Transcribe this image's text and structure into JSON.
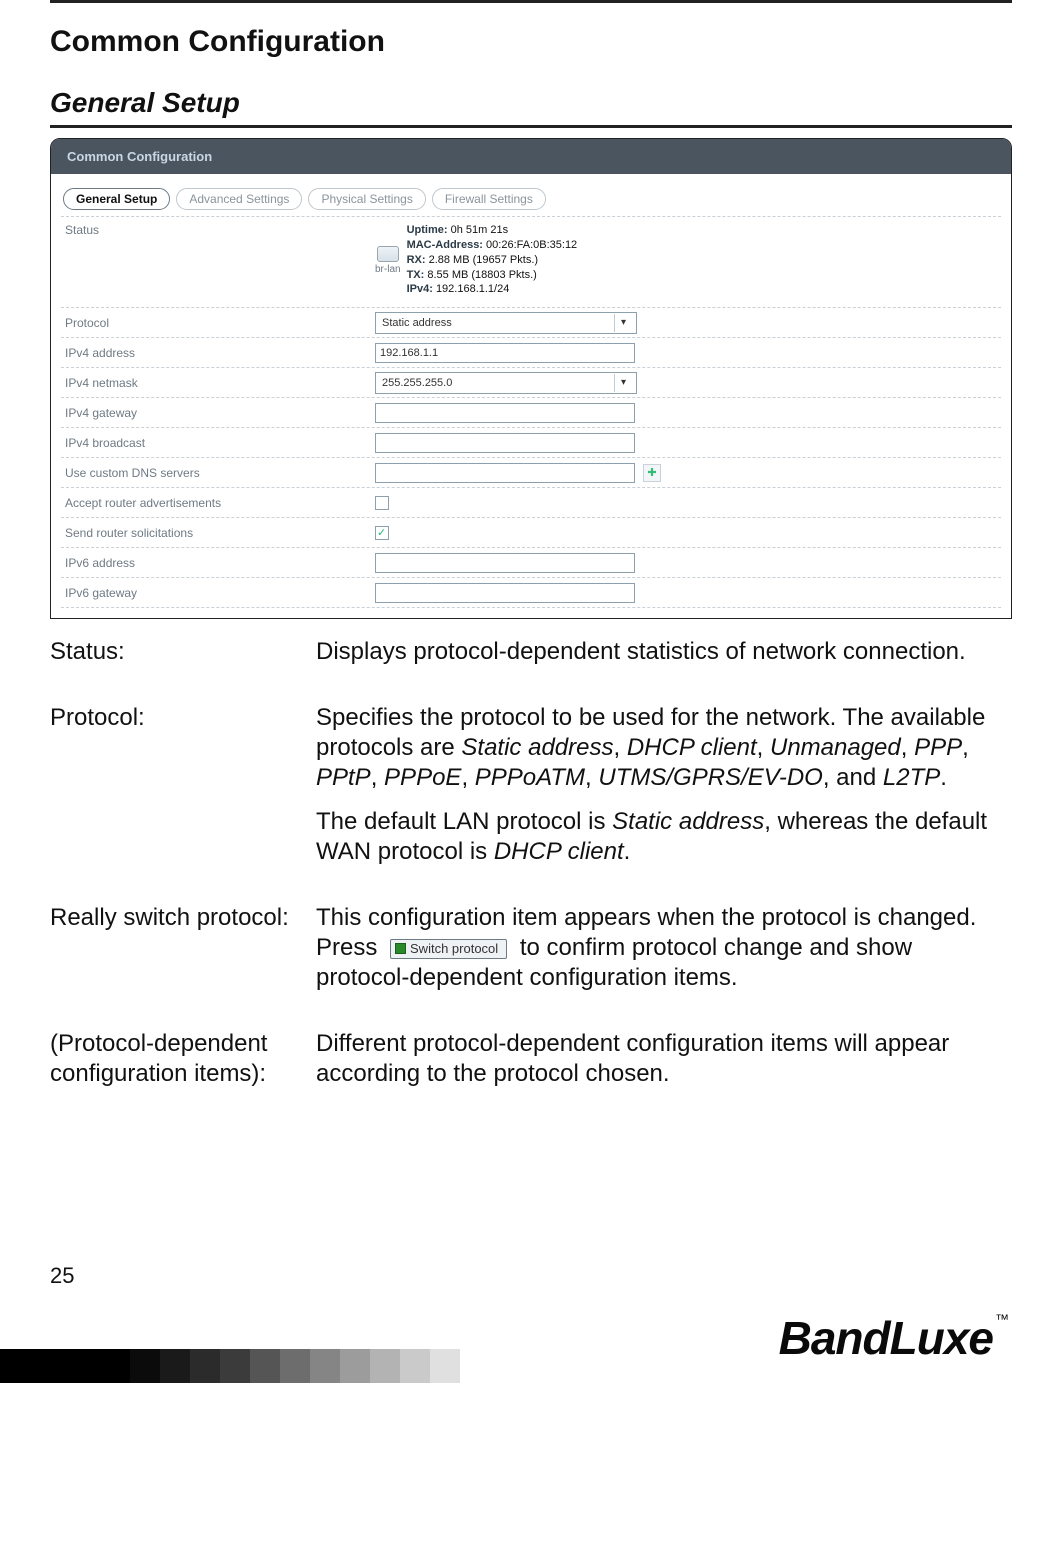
{
  "page": {
    "number": "25",
    "title": "Common Configuration",
    "section": "General Setup",
    "brand": "BandLuxe",
    "tm": "™"
  },
  "panel": {
    "header": "Common Configuration",
    "tabs": [
      "General Setup",
      "Advanced Settings",
      "Physical Settings",
      "Firewall Settings"
    ],
    "status": {
      "label": "Status",
      "iface": "br-lan",
      "uptime_label": "Uptime:",
      "uptime": "0h 51m 21s",
      "mac_label": "MAC-Address:",
      "mac": "00:26:FA:0B:35:12",
      "rx_label": "RX:",
      "rx": "2.88 MB (19657 Pkts.)",
      "tx_label": "TX:",
      "tx": "8.55 MB (18803 Pkts.)",
      "ipv4_label": "IPv4:",
      "ipv4": "192.168.1.1/24"
    },
    "rows": {
      "protocol": {
        "label": "Protocol",
        "value": "Static address"
      },
      "ipv4addr": {
        "label": "IPv4 address",
        "value": "192.168.1.1"
      },
      "ipv4mask": {
        "label": "IPv4 netmask",
        "value": "255.255.255.0"
      },
      "ipv4gw": {
        "label": "IPv4 gateway",
        "value": ""
      },
      "ipv4bc": {
        "label": "IPv4 broadcast",
        "value": ""
      },
      "dns": {
        "label": "Use custom DNS servers",
        "value": ""
      },
      "accept_ra": {
        "label": "Accept router advertisements"
      },
      "send_rs": {
        "label": "Send router solicitations"
      },
      "ipv6addr": {
        "label": "IPv6 address",
        "value": ""
      },
      "ipv6gw": {
        "label": "IPv6 gateway",
        "value": ""
      }
    }
  },
  "desc": {
    "status": {
      "term": "Status:",
      "text": "Displays protocol-dependent statistics of network connection."
    },
    "protocol": {
      "term": "Protocol:",
      "p1a": "Specifies the protocol to be used for the network. The available protocols are ",
      "i1": "Static address",
      "c1": ", ",
      "i2": "DHCP client",
      "c2": ", ",
      "i3": "Unmanaged",
      "c3": ", ",
      "i4": "PPP",
      "c4": ", ",
      "i5": "PPtP",
      "c5": ", ",
      "i6": "PPPoE",
      "c6": ", ",
      "i7": "PPPoATM",
      "c7": ", ",
      "i8": "UTMS/GPRS/EV-DO",
      "c8": ", and ",
      "i9": "L2TP",
      "p1b": ".",
      "p2a": "The default LAN protocol is ",
      "i10": "Static address",
      "p2b": ", whereas the default WAN protocol is ",
      "i11": "DHCP client",
      "p2c": "."
    },
    "switch": {
      "term": "Really switch protocol:",
      "t1": "This configuration item appears when the protocol is changed. Press ",
      "btn": "Switch protocol",
      "t2": " to confirm protocol change and show protocol-dependent configuration items."
    },
    "pdep": {
      "term": "(Protocol-dependent configuration items):",
      "text": "Different protocol-dependent configuration items will appear according to the protocol chosen."
    }
  },
  "footer_squares": [
    "#0b0b0b",
    "#1a1a1a",
    "#2b2b2b",
    "#3b3b3b",
    "#555",
    "#6d6d6d",
    "#858585",
    "#9c9c9c",
    "#b3b3b3",
    "#cacaca",
    "#e0e0e0"
  ]
}
